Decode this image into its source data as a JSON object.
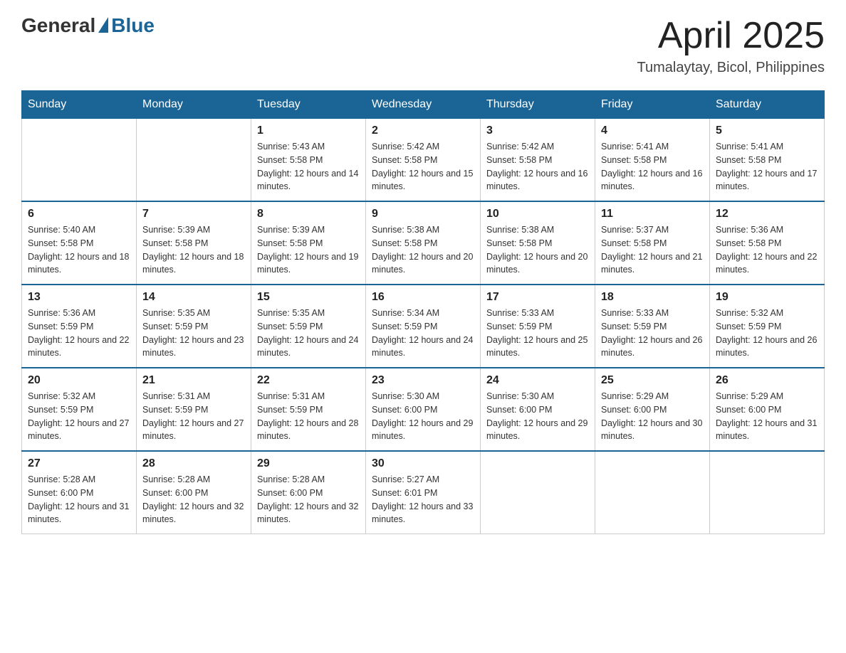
{
  "header": {
    "logo_general": "General",
    "logo_blue": "Blue",
    "month_title": "April 2025",
    "location": "Tumalaytay, Bicol, Philippines"
  },
  "days_of_week": [
    "Sunday",
    "Monday",
    "Tuesday",
    "Wednesday",
    "Thursday",
    "Friday",
    "Saturday"
  ],
  "weeks": [
    [
      {
        "day": "",
        "sunrise": "",
        "sunset": "",
        "daylight": ""
      },
      {
        "day": "",
        "sunrise": "",
        "sunset": "",
        "daylight": ""
      },
      {
        "day": "1",
        "sunrise": "Sunrise: 5:43 AM",
        "sunset": "Sunset: 5:58 PM",
        "daylight": "Daylight: 12 hours and 14 minutes."
      },
      {
        "day": "2",
        "sunrise": "Sunrise: 5:42 AM",
        "sunset": "Sunset: 5:58 PM",
        "daylight": "Daylight: 12 hours and 15 minutes."
      },
      {
        "day": "3",
        "sunrise": "Sunrise: 5:42 AM",
        "sunset": "Sunset: 5:58 PM",
        "daylight": "Daylight: 12 hours and 16 minutes."
      },
      {
        "day": "4",
        "sunrise": "Sunrise: 5:41 AM",
        "sunset": "Sunset: 5:58 PM",
        "daylight": "Daylight: 12 hours and 16 minutes."
      },
      {
        "day": "5",
        "sunrise": "Sunrise: 5:41 AM",
        "sunset": "Sunset: 5:58 PM",
        "daylight": "Daylight: 12 hours and 17 minutes."
      }
    ],
    [
      {
        "day": "6",
        "sunrise": "Sunrise: 5:40 AM",
        "sunset": "Sunset: 5:58 PM",
        "daylight": "Daylight: 12 hours and 18 minutes."
      },
      {
        "day": "7",
        "sunrise": "Sunrise: 5:39 AM",
        "sunset": "Sunset: 5:58 PM",
        "daylight": "Daylight: 12 hours and 18 minutes."
      },
      {
        "day": "8",
        "sunrise": "Sunrise: 5:39 AM",
        "sunset": "Sunset: 5:58 PM",
        "daylight": "Daylight: 12 hours and 19 minutes."
      },
      {
        "day": "9",
        "sunrise": "Sunrise: 5:38 AM",
        "sunset": "Sunset: 5:58 PM",
        "daylight": "Daylight: 12 hours and 20 minutes."
      },
      {
        "day": "10",
        "sunrise": "Sunrise: 5:38 AM",
        "sunset": "Sunset: 5:58 PM",
        "daylight": "Daylight: 12 hours and 20 minutes."
      },
      {
        "day": "11",
        "sunrise": "Sunrise: 5:37 AM",
        "sunset": "Sunset: 5:58 PM",
        "daylight": "Daylight: 12 hours and 21 minutes."
      },
      {
        "day": "12",
        "sunrise": "Sunrise: 5:36 AM",
        "sunset": "Sunset: 5:58 PM",
        "daylight": "Daylight: 12 hours and 22 minutes."
      }
    ],
    [
      {
        "day": "13",
        "sunrise": "Sunrise: 5:36 AM",
        "sunset": "Sunset: 5:59 PM",
        "daylight": "Daylight: 12 hours and 22 minutes."
      },
      {
        "day": "14",
        "sunrise": "Sunrise: 5:35 AM",
        "sunset": "Sunset: 5:59 PM",
        "daylight": "Daylight: 12 hours and 23 minutes."
      },
      {
        "day": "15",
        "sunrise": "Sunrise: 5:35 AM",
        "sunset": "Sunset: 5:59 PM",
        "daylight": "Daylight: 12 hours and 24 minutes."
      },
      {
        "day": "16",
        "sunrise": "Sunrise: 5:34 AM",
        "sunset": "Sunset: 5:59 PM",
        "daylight": "Daylight: 12 hours and 24 minutes."
      },
      {
        "day": "17",
        "sunrise": "Sunrise: 5:33 AM",
        "sunset": "Sunset: 5:59 PM",
        "daylight": "Daylight: 12 hours and 25 minutes."
      },
      {
        "day": "18",
        "sunrise": "Sunrise: 5:33 AM",
        "sunset": "Sunset: 5:59 PM",
        "daylight": "Daylight: 12 hours and 26 minutes."
      },
      {
        "day": "19",
        "sunrise": "Sunrise: 5:32 AM",
        "sunset": "Sunset: 5:59 PM",
        "daylight": "Daylight: 12 hours and 26 minutes."
      }
    ],
    [
      {
        "day": "20",
        "sunrise": "Sunrise: 5:32 AM",
        "sunset": "Sunset: 5:59 PM",
        "daylight": "Daylight: 12 hours and 27 minutes."
      },
      {
        "day": "21",
        "sunrise": "Sunrise: 5:31 AM",
        "sunset": "Sunset: 5:59 PM",
        "daylight": "Daylight: 12 hours and 27 minutes."
      },
      {
        "day": "22",
        "sunrise": "Sunrise: 5:31 AM",
        "sunset": "Sunset: 5:59 PM",
        "daylight": "Daylight: 12 hours and 28 minutes."
      },
      {
        "day": "23",
        "sunrise": "Sunrise: 5:30 AM",
        "sunset": "Sunset: 6:00 PM",
        "daylight": "Daylight: 12 hours and 29 minutes."
      },
      {
        "day": "24",
        "sunrise": "Sunrise: 5:30 AM",
        "sunset": "Sunset: 6:00 PM",
        "daylight": "Daylight: 12 hours and 29 minutes."
      },
      {
        "day": "25",
        "sunrise": "Sunrise: 5:29 AM",
        "sunset": "Sunset: 6:00 PM",
        "daylight": "Daylight: 12 hours and 30 minutes."
      },
      {
        "day": "26",
        "sunrise": "Sunrise: 5:29 AM",
        "sunset": "Sunset: 6:00 PM",
        "daylight": "Daylight: 12 hours and 31 minutes."
      }
    ],
    [
      {
        "day": "27",
        "sunrise": "Sunrise: 5:28 AM",
        "sunset": "Sunset: 6:00 PM",
        "daylight": "Daylight: 12 hours and 31 minutes."
      },
      {
        "day": "28",
        "sunrise": "Sunrise: 5:28 AM",
        "sunset": "Sunset: 6:00 PM",
        "daylight": "Daylight: 12 hours and 32 minutes."
      },
      {
        "day": "29",
        "sunrise": "Sunrise: 5:28 AM",
        "sunset": "Sunset: 6:00 PM",
        "daylight": "Daylight: 12 hours and 32 minutes."
      },
      {
        "day": "30",
        "sunrise": "Sunrise: 5:27 AM",
        "sunset": "Sunset: 6:01 PM",
        "daylight": "Daylight: 12 hours and 33 minutes."
      },
      {
        "day": "",
        "sunrise": "",
        "sunset": "",
        "daylight": ""
      },
      {
        "day": "",
        "sunrise": "",
        "sunset": "",
        "daylight": ""
      },
      {
        "day": "",
        "sunrise": "",
        "sunset": "",
        "daylight": ""
      }
    ]
  ]
}
